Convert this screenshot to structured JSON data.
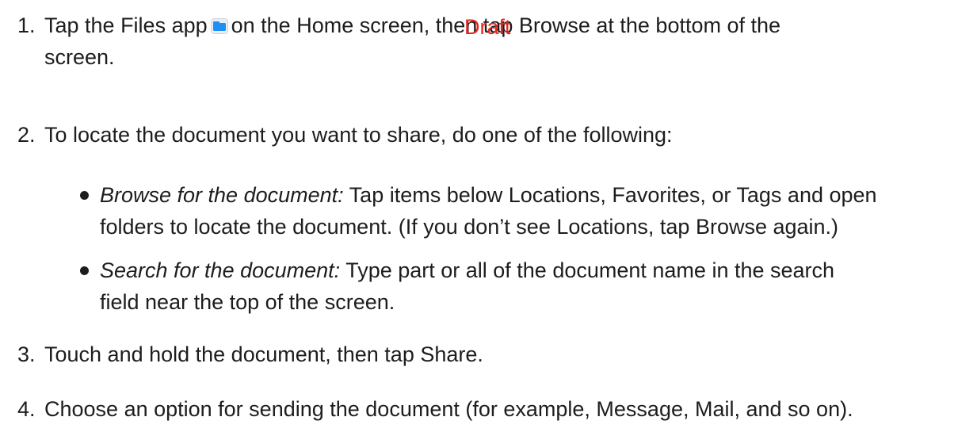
{
  "watermark": "Draft",
  "steps": [
    {
      "number": "1.",
      "line1_before_icon": "Tap the Files app",
      "line1_after_icon": "on the Home screen, then tap Browse at the bottom of the",
      "line2": "screen.",
      "icon": "files-app-icon"
    },
    {
      "number": "2.",
      "text": "To locate the document you want to share, do one of the following:"
    },
    {
      "number": "3.",
      "text": "Touch and hold the document, then tap Share."
    },
    {
      "number": "4.",
      "text": "Choose an option for sending the document (for example, Message, Mail, and so on)."
    }
  ],
  "bullets": [
    {
      "label": "Browse for the document:",
      "line1": "Tap items below Locations, Favorites, or Tags and open",
      "line2": "folders to locate the document. (If you don’t see Locations, tap Browse again.)"
    },
    {
      "label": "Search for the document:",
      "line1": "Type part or all of the document name in the search",
      "line2": "field near the top of the screen."
    }
  ],
  "colors": {
    "text": "#1d1d1f",
    "watermark": "#e8241e",
    "files_icon_blue": "#1e8ff5"
  }
}
